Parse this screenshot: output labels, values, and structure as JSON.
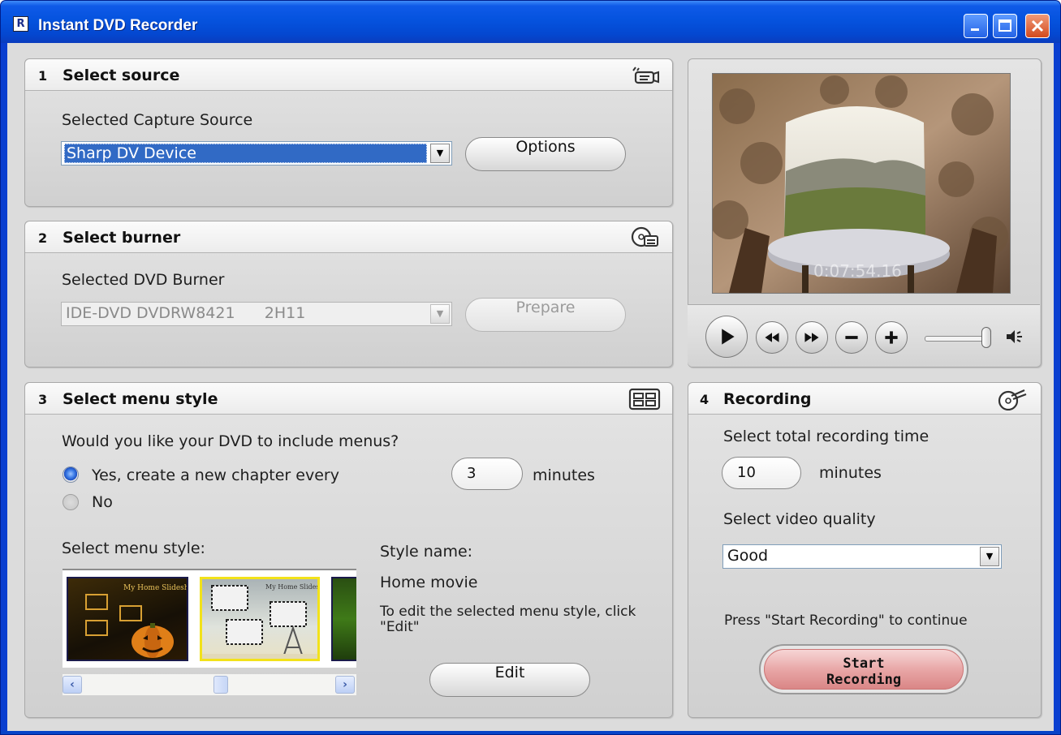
{
  "window": {
    "title": "Instant DVD Recorder",
    "icon_letter": "R"
  },
  "source": {
    "number": "1",
    "title": "Select source",
    "field_label": "Selected Capture Source",
    "selected": "Sharp DV Device",
    "options_button": "Options",
    "icon": "camcorder-icon"
  },
  "burner": {
    "number": "2",
    "title": "Select burner",
    "field_label": "Selected DVD Burner",
    "selected": "IDE-DVD DVDRW8421      2H11",
    "prepare_button": "Prepare",
    "icon": "disc-burner-icon"
  },
  "menu": {
    "number": "3",
    "title": "Select menu style",
    "question": "Would you like your DVD to include menus?",
    "yes_label": "Yes, create a new chapter every",
    "chapter_minutes": "3",
    "minutes_unit": "minutes",
    "no_label": "No",
    "selected_option": "yes",
    "style_list_label": "Select menu style:",
    "style_name_label": "Style name:",
    "style_name": "Home movie",
    "edit_hint": "To edit the selected menu style, click \"Edit\"",
    "edit_button": "Edit",
    "thumbnails": [
      {
        "name": "Halloween",
        "title": "My Home Slideshow"
      },
      {
        "name": "Home movie",
        "title": "My Home Slideshow",
        "selected": true
      },
      {
        "name": "Green",
        "title": ""
      }
    ],
    "icon": "menu-layout-icon"
  },
  "player": {
    "timecode": "0:07:54.16",
    "controls": [
      "play-button",
      "rewind-button",
      "fast-forward-button",
      "zoom-out-button",
      "zoom-in-button"
    ],
    "volume_level": 0.95,
    "icon": "speaker-icon"
  },
  "recording": {
    "number": "4",
    "title": "Recording",
    "time_label": "Select total recording time",
    "total_minutes": "10",
    "minutes_unit": "minutes",
    "quality_label": "Select video quality",
    "quality": "Good",
    "hint": "Press \"Start Recording\" to continue",
    "start_button": "Start\nRecording",
    "icon": "record-disc-icon"
  },
  "colors": {
    "titlebar": "#0553de",
    "selection": "#316ac5",
    "start_button": "#e7a3a3",
    "panel": "#dcdcdc"
  }
}
